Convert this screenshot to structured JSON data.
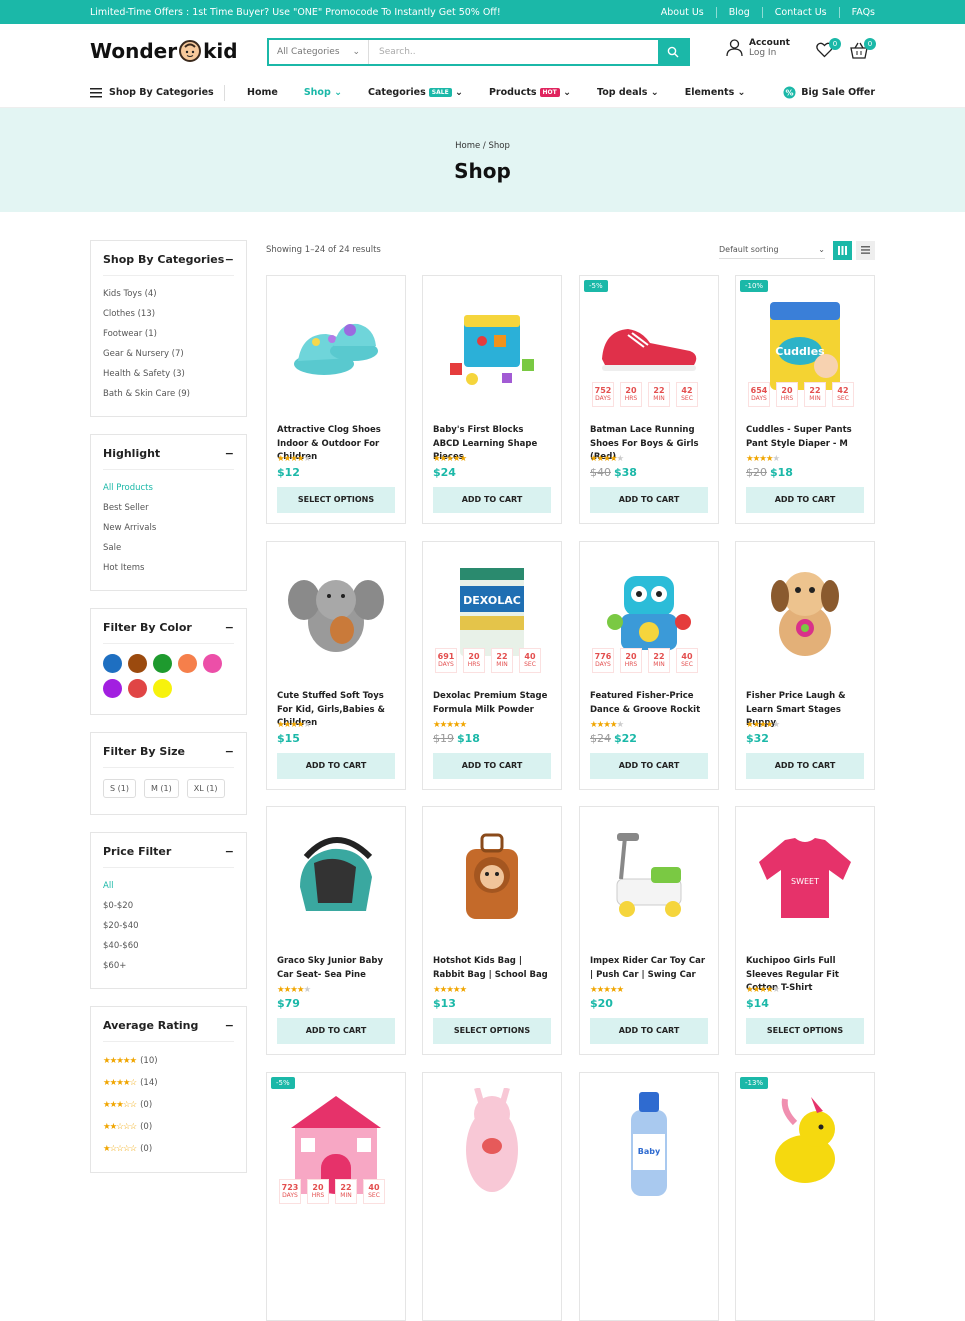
{
  "promo_bar": {
    "text": "Limited-Time Offers : 1st Time Buyer? Use \"ONE\" Promocode To Instantly Get 50% Off!",
    "links": [
      "About Us",
      "Blog",
      "Contact Us",
      "FAQs"
    ]
  },
  "header": {
    "logo_part1": "Wonder",
    "logo_part2": "kid",
    "search_category": "All Categories",
    "search_placeholder": "Search..",
    "account_title": "Account",
    "account_sub": "Log In",
    "wishlist_count": "0",
    "cart_count": "0"
  },
  "nav": {
    "shop_by": "Shop By Categories",
    "items": [
      "Home",
      "Shop",
      "Categories",
      "Products",
      "Top deals",
      "Elements"
    ],
    "categories_badge": "SALE",
    "products_badge": "HOT",
    "big_sale": "Big Sale Offer"
  },
  "hero": {
    "breadcrumb": "Home / Shop",
    "title": "Shop"
  },
  "sidebar": {
    "categories": {
      "title": "Shop By Categories",
      "items": [
        "Kids Toys (4)",
        "Clothes (13)",
        "Footwear (1)",
        "Gear & Nursery (7)",
        "Health & Safety (3)",
        "Bath & Skin Care (9)"
      ]
    },
    "highlight": {
      "title": "Highlight",
      "items": [
        "All Products",
        "Best Seller",
        "New Arrivals",
        "Sale",
        "Hot Items"
      ]
    },
    "color": {
      "title": "Filter By Color",
      "swatches": [
        "#1e6fc1",
        "#9b4a0e",
        "#1e9a2e",
        "#f57f4b",
        "#ec4fa8",
        "#a21fe0",
        "#e04545",
        "#f7f20c"
      ]
    },
    "size": {
      "title": "Filter By Size",
      "items": [
        "S (1)",
        "M (1)",
        "XL (1)"
      ]
    },
    "price": {
      "title": "Price Filter",
      "items": [
        "All",
        "$0-$20",
        "$20-$40",
        "$40-$60",
        "$60+"
      ]
    },
    "rating": {
      "title": "Average Rating",
      "items": [
        {
          "stars": 5,
          "count": "(10)"
        },
        {
          "stars": 4,
          "count": "(14)"
        },
        {
          "stars": 3,
          "count": "(0)"
        },
        {
          "stars": 2,
          "count": "(0)"
        },
        {
          "stars": 1,
          "count": "(0)"
        }
      ]
    }
  },
  "toolbar": {
    "results": "Showing 1–24 of 24 results",
    "sorting": "Default sorting"
  },
  "countdown_labels": [
    "DAYS",
    "HRS",
    "MIN",
    "SEC"
  ],
  "products": [
    {
      "name": "Attractive Clog Shoes Indoor & Outdoor For Children",
      "rating": 4,
      "old_price": "",
      "price": "$12",
      "cta": "SELECT OPTIONS",
      "sale": "",
      "countdown": null,
      "image": "clog-shoes"
    },
    {
      "name": "Baby's First Blocks ABCD Learning Shape Pieces",
      "rating": 5,
      "old_price": "",
      "price": "$24",
      "cta": "ADD TO CART",
      "sale": "",
      "countdown": null,
      "image": "blocks-bucket"
    },
    {
      "name": "Batman Lace Running Shoes For Boys & Girls (Red)",
      "rating": 4,
      "old_price": "$40",
      "price": "$38",
      "cta": "ADD TO CART",
      "sale": "-5%",
      "countdown": [
        "752",
        "20",
        "22",
        "42"
      ],
      "image": "red-shoe"
    },
    {
      "name": "Cuddles - Super Pants Pant Style Diaper - M",
      "rating": 4,
      "old_price": "$20",
      "price": "$18",
      "cta": "ADD TO CART",
      "sale": "-10%",
      "countdown": [
        "654",
        "20",
        "22",
        "42"
      ],
      "image": "diaper-pack"
    },
    {
      "name": "Cute Stuffed Soft Toys For Kid, Girls,Babies & Children",
      "rating": 4,
      "old_price": "",
      "price": "$15",
      "cta": "ADD TO CART",
      "sale": "",
      "countdown": null,
      "image": "elephant-toy"
    },
    {
      "name": "Dexolac Premium Stage Formula Milk Powder",
      "rating": 5,
      "old_price": "$19",
      "price": "$18",
      "cta": "ADD TO CART",
      "sale": "",
      "countdown": [
        "691",
        "20",
        "22",
        "40"
      ],
      "image": "milk-tin"
    },
    {
      "name": "Featured Fisher-Price Dance & Groove Rockit",
      "rating": 4,
      "old_price": "$24",
      "price": "$22",
      "cta": "ADD TO CART",
      "sale": "",
      "countdown": [
        "776",
        "20",
        "22",
        "40"
      ],
      "image": "robot-toy"
    },
    {
      "name": "Fisher Price Laugh & Learn Smart Stages Puppy",
      "rating": 4,
      "old_price": "",
      "price": "$32",
      "cta": "ADD TO CART",
      "sale": "",
      "countdown": null,
      "image": "puppy-toy"
    },
    {
      "name": "Graco Sky Junior Baby Car Seat- Sea Pine",
      "rating": 4,
      "old_price": "",
      "price": "$79",
      "cta": "ADD TO CART",
      "sale": "",
      "countdown": null,
      "image": "car-seat"
    },
    {
      "name": "Hotshot Kids Bag | Rabbit Bag | School Bag",
      "rating": 5,
      "old_price": "",
      "price": "$13",
      "cta": "SELECT OPTIONS",
      "sale": "",
      "countdown": null,
      "image": "lion-bag"
    },
    {
      "name": "Impex Rider Car Toy Car | Push Car | Swing Car",
      "rating": 5,
      "old_price": "",
      "price": "$20",
      "cta": "ADD TO CART",
      "sale": "",
      "countdown": null,
      "image": "ride-car"
    },
    {
      "name": "Kuchipoo Girls Full Sleeves Regular Fit Cotton T-Shirt",
      "rating": 4,
      "old_price": "",
      "price": "$14",
      "cta": "SELECT OPTIONS",
      "sale": "",
      "countdown": null,
      "image": "pink-shirt"
    },
    {
      "name": "",
      "rating": 0,
      "old_price": "",
      "price": "",
      "cta": "",
      "sale": "-5%",
      "countdown": [
        "723",
        "20",
        "22",
        "40"
      ],
      "image": "play-tent"
    },
    {
      "name": "",
      "rating": 0,
      "old_price": "",
      "price": "",
      "cta": "",
      "sale": "",
      "countdown": null,
      "image": "baby-wrap"
    },
    {
      "name": "",
      "rating": 0,
      "old_price": "",
      "price": "",
      "cta": "",
      "sale": "",
      "countdown": null,
      "image": "shampoo-bottle"
    },
    {
      "name": "",
      "rating": 0,
      "old_price": "",
      "price": "",
      "cta": "",
      "sale": "-13%",
      "countdown": null,
      "image": "unicorn-plush"
    }
  ],
  "colors": {
    "accent": "#1bb8a8",
    "sale_badge": "#1bb8a8",
    "hot_badge": "#e0245e",
    "star": "#f0a500",
    "countdown": "#e34f4f"
  }
}
